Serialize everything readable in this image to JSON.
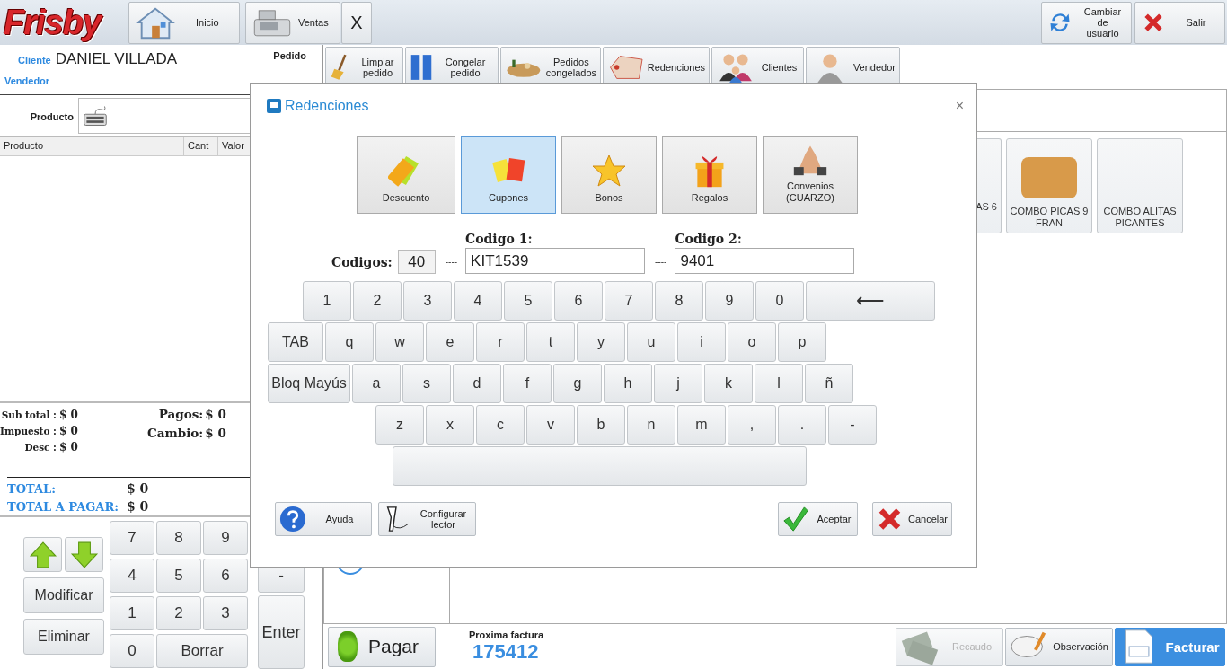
{
  "top_bar": {
    "logo": "Frisby",
    "nav": [
      {
        "label": "Inicio",
        "kind": "home"
      },
      {
        "label": "Ventas",
        "kind": "register"
      },
      {
        "label": "X",
        "kind": "close"
      }
    ],
    "actions": [
      {
        "label": "Cambiar de usuario",
        "kind": "switch"
      },
      {
        "label": "Salir",
        "kind": "exit"
      }
    ]
  },
  "order": {
    "client_label": "Cliente",
    "client": "DANIEL VILLADA",
    "order_label": "Pedido",
    "seller_label": "Vendedor",
    "product_label": "Producto"
  },
  "table": {
    "columns": [
      "Producto",
      "Cant",
      "Valor"
    ]
  },
  "totals": {
    "rows": [
      {
        "label": "Sub total :",
        "value": "$ 0"
      },
      {
        "label": "Impuesto :",
        "value": "$ 0"
      },
      {
        "label": "Desc :",
        "value": "$ 0"
      }
    ],
    "payments": [
      {
        "label": "Pagos:",
        "value": "$ 0"
      },
      {
        "label": "Cambio:",
        "value": "$ 0"
      }
    ],
    "grand": [
      {
        "label": "TOTAL:",
        "value": "$ 0"
      },
      {
        "label": "TOTAL A PAGAR:",
        "value": "$ 0"
      }
    ]
  },
  "keypad": {
    "side": [
      "Modificar",
      "Eliminar"
    ],
    "digits": [
      "7",
      "8",
      "9",
      "4",
      "5",
      "6",
      "1",
      "2",
      "3",
      "0",
      "Borrar"
    ],
    "ops": [
      "-",
      "Enter"
    ]
  },
  "toolbar": [
    {
      "label": "Limpiar pedido"
    },
    {
      "label": "Congelar pedido"
    },
    {
      "label": "Pedidos congelados"
    },
    {
      "label": "Redenciones"
    },
    {
      "label": "Clientes"
    },
    {
      "label": "Vendedor"
    }
  ],
  "products": [
    {
      "name": "AS 6",
      "kind": "partial"
    },
    {
      "name": "COMBO PICAS 9 FRAN",
      "kind": "photo"
    },
    {
      "name": "COMBO ALITAS PICANTES",
      "kind": "plain"
    }
  ],
  "bottom_bar": {
    "pay": "Pagar",
    "next_invoice_label": "Proxima factura",
    "next_invoice": "175412",
    "actions": [
      {
        "label": "Recaudo",
        "kind": "money",
        "disabled": true
      },
      {
        "label": "Observación",
        "kind": "note",
        "disabled": false
      },
      {
        "label": "Facturar",
        "kind": "invoice",
        "disabled": false
      }
    ]
  },
  "dialog": {
    "title": "Redenciones",
    "close": "×",
    "tiles": [
      {
        "label": "Descuento",
        "selected": false
      },
      {
        "label": "Cupones",
        "selected": true
      },
      {
        "label": "Bonos",
        "selected": false
      },
      {
        "label": "Regalos",
        "selected": false
      },
      {
        "label": "Convenios (CUARZO)",
        "selected": false
      }
    ],
    "codes_label": "Codigos:",
    "codes_value": "40",
    "separator_1": "----",
    "code_1_label": "Codigo 1:",
    "code_1": "KIT1539",
    "separator_2": "----",
    "code_2_label": "Codigo 2:",
    "code_2": "9401",
    "keyboard": [
      [
        {
          "label": "1",
          "kind": "key"
        },
        {
          "label": "2",
          "kind": "key"
        },
        {
          "label": "3",
          "kind": "key"
        },
        {
          "label": "4",
          "kind": "key"
        },
        {
          "label": "5",
          "kind": "key"
        },
        {
          "label": "6",
          "kind": "key"
        },
        {
          "label": "7",
          "kind": "key"
        },
        {
          "label": "8",
          "kind": "key"
        },
        {
          "label": "9",
          "kind": "key"
        },
        {
          "label": "0",
          "kind": "key"
        },
        {
          "label": "⟵",
          "kind": "backspace"
        }
      ],
      [
        {
          "label": "TAB",
          "kind": "tab"
        },
        {
          "label": "q",
          "kind": "key"
        },
        {
          "label": "w",
          "kind": "key"
        },
        {
          "label": "e",
          "kind": "key"
        },
        {
          "label": "r",
          "kind": "key"
        },
        {
          "label": "t",
          "kind": "key"
        },
        {
          "label": "y",
          "kind": "key"
        },
        {
          "label": "u",
          "kind": "key"
        },
        {
          "label": "i",
          "kind": "key"
        },
        {
          "label": "o",
          "kind": "key"
        },
        {
          "label": "p",
          "kind": "key"
        }
      ],
      [
        {
          "label": "Bloq Mayús",
          "kind": "caps"
        },
        {
          "label": "a",
          "kind": "key"
        },
        {
          "label": "s",
          "kind": "key"
        },
        {
          "label": "d",
          "kind": "key"
        },
        {
          "label": "f",
          "kind": "key"
        },
        {
          "label": "g",
          "kind": "key"
        },
        {
          "label": "h",
          "kind": "key"
        },
        {
          "label": "j",
          "kind": "key"
        },
        {
          "label": "k",
          "kind": "key"
        },
        {
          "label": "l",
          "kind": "key"
        },
        {
          "label": "ñ",
          "kind": "key"
        }
      ],
      [
        {
          "label": "z",
          "kind": "key"
        },
        {
          "label": "x",
          "kind": "key"
        },
        {
          "label": "c",
          "kind": "key"
        },
        {
          "label": "v",
          "kind": "key"
        },
        {
          "label": "b",
          "kind": "key"
        },
        {
          "label": "n",
          "kind": "key"
        },
        {
          "label": "m",
          "kind": "key"
        },
        {
          "label": ",",
          "kind": "key"
        },
        {
          "label": ".",
          "kind": "key"
        },
        {
          "label": "-",
          "kind": "key"
        }
      ],
      [
        {
          "kind": "space"
        }
      ]
    ],
    "buttons": [
      {
        "label": "Ayuda",
        "kind": "help"
      },
      {
        "label": "Configurar lector",
        "kind": "scanner"
      },
      {
        "label": "Aceptar",
        "kind": "ok"
      },
      {
        "label": "Cancelar",
        "kind": "cancel"
      }
    ]
  }
}
